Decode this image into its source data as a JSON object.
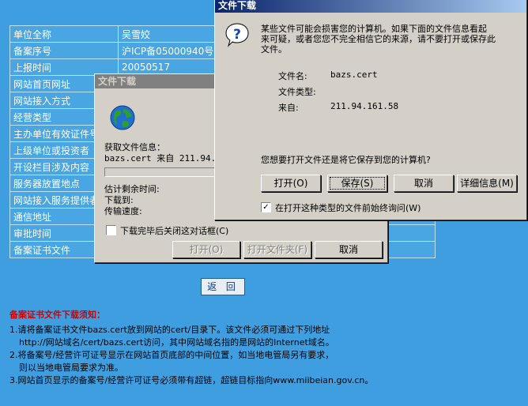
{
  "record": {
    "rows": [
      {
        "label": "单位全称",
        "value": "吴雪姣"
      },
      {
        "label": "备案序号",
        "value": "沪ICP备05000940号"
      },
      {
        "label": "上报时间",
        "value": "20050517"
      },
      {
        "label": "网站首页网址",
        "value": ""
      },
      {
        "label": "网站接入方式",
        "value": ""
      },
      {
        "label": "经营类型",
        "value": ""
      },
      {
        "label": "主办单位有效证件号",
        "value": ""
      },
      {
        "label": "上级单位或投资者",
        "value": ""
      },
      {
        "label": "开设栏目涉及内容",
        "value": ""
      },
      {
        "label": "服务器放置地点",
        "value": ""
      },
      {
        "label": "网站接入服务提供者",
        "value": ""
      },
      {
        "label": "通信地址",
        "value": ""
      },
      {
        "label": "审批时间",
        "value": ""
      },
      {
        "label": "备案证书文件",
        "value": ""
      }
    ],
    "back_label": "返 回"
  },
  "notice": {
    "title": "备案证书文件下载须知：",
    "lines": [
      "1.请将备案证书文件bazs.cert放到网站的cert/目录下。该文件必须可通过下列地址",
      "http://网站域名/cert/bazs.cert访问，其中网站域名指的是网站的Internet域名。",
      "2.将备案号/经营许可证号显示在网站首页底部的中间位置，如当地电管局另有要求，",
      "则以当地电管局要求为准。",
      "3.网站首页显示的备案号/经营许可证号必须带有超链，超链目标指向www.miibeian.gov.cn。"
    ]
  },
  "progress_dialog": {
    "title": "文件下载",
    "info_label": "获取文件信息：",
    "info_detail": "bazs.cert 来自 211.94.1",
    "remaining_label": "估计剩余时间:",
    "download_to_label": "下载到:",
    "speed_label": "传输速度:",
    "close_checkbox_label": "下载完毕后关闭这对话框(C)",
    "close_checkbox_checked": false,
    "progress": 0,
    "buttons": {
      "open": "打开(O)",
      "open_folder": "打开文件夹(F)",
      "cancel": "取消"
    }
  },
  "warning_dialog": {
    "title": "文件下载",
    "message": "某些文件可能会损害您的计算机。如果下面的文件信息看起来可疑，或者您您不完全相信它的来源，请不要打开或保存此文件。",
    "message_lines": [
      "某些文件可能会损害您的计算机。如果下面的文件信息看起",
      "来可疑，或者您您不完全相信它的来源，请不要打开或保存此",
      "文件。"
    ],
    "filename_label": "文件名:",
    "filename": "bazs.cert",
    "filetype_label": "文件类型:",
    "filetype": "",
    "from_label": "来自:",
    "from": "211.94.161.58",
    "question": "您想要打开文件还是将它保存到您的计算机?",
    "buttons": {
      "open": "打开(O)",
      "save": "保存(S)",
      "cancel": "取消",
      "details": "详细信息(M)"
    },
    "always_ask_label": "在打开这种类型的文件前始终询问(W)",
    "always_ask_checked": true
  },
  "icons": {
    "question": "question-icon",
    "globe": "globe-icon"
  },
  "colors": {
    "background": "#3f9ee0",
    "title_active": "#0a246a",
    "notice_title": "#d40000"
  }
}
